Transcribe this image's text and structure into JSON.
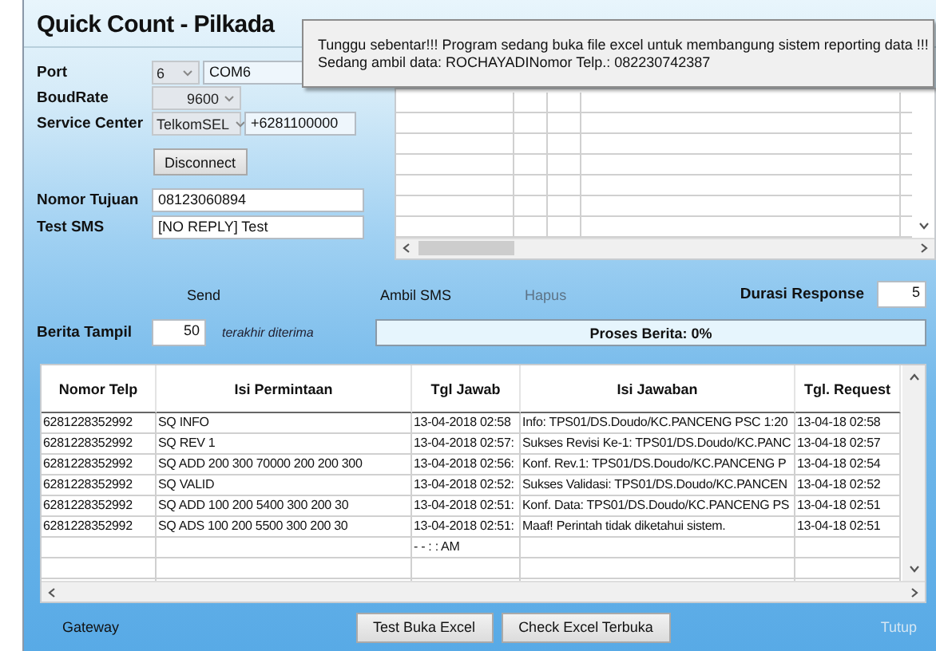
{
  "window": {
    "title": "Quick Count - Pilkada"
  },
  "notification": {
    "lines": [
      "Tunggu sebentar!!! Program sedang buka file excel untuk membangung sistem reporting data !!!",
      "Sedang ambil data: ROCHAYADINomor Telp.: 082230742387"
    ]
  },
  "settings": {
    "port": {
      "label": "Port",
      "number": "6",
      "name": "COM6"
    },
    "baud_rate": {
      "label": "BoudRate",
      "value": "9600"
    },
    "service_center": {
      "label": "Service Center",
      "operator": "TelkomSEL",
      "number": "+6281100000"
    }
  },
  "disconnect_button": "Disconnect",
  "destination": {
    "label": "Nomor Tujuan",
    "value": "08123060894"
  },
  "test_sms": {
    "label": "Test SMS",
    "value": "[NO REPLY] Test"
  },
  "actions": [
    {
      "label": "Send",
      "disabled": false
    },
    {
      "label": "Ambil SMS",
      "disabled": false
    },
    {
      "label": "Hapus",
      "disabled": true
    }
  ],
  "response_duration": {
    "label": "Durasi Response",
    "value": "5"
  },
  "shown": {
    "label": "Berita Tampil",
    "value": "50",
    "note": "terakhir diterima"
  },
  "progress": {
    "label": "Proses Berita: 0%",
    "level": 0
  },
  "table": {
    "columns": [
      "Nomor Telp",
      "Isi Permintaan",
      "Tgl Jawab",
      "Isi Jawaban",
      "Tgl. Request"
    ],
    "rows": [
      [
        "6281228352992",
        "SQ INFO",
        "13-04-2018 02:58",
        "Info: TPS01/DS.Doudo/KC.PANCENG PSC 1:20",
        "13-04-18 02:58"
      ],
      [
        "6281228352992",
        "SQ REV 1",
        "13-04-2018 02:57:",
        "Sukses Revisi Ke-1: TPS01/DS.Doudo/KC.PANC",
        "13-04-18 02:57"
      ],
      [
        "6281228352992",
        "SQ ADD 200 300 70000 200 200 300",
        "13-04-2018 02:56:",
        "Konf. Rev.1: TPS01/DS.Doudo/KC.PANCENG P",
        "13-04-18 02:54"
      ],
      [
        "6281228352992",
        "SQ VALID",
        "13-04-2018 02:52:",
        "Sukses Validasi: TPS01/DS.Doudo/KC.PANCEN",
        "13-04-18 02:52"
      ],
      [
        "6281228352992",
        "SQ ADD 100 200 5400 300 200 30",
        "13-04-2018 02:51:",
        "Konf. Data: TPS01/DS.Doudo/KC.PANCENG PS",
        "13-04-18 02:51"
      ],
      [
        "6281228352992",
        "SQ ADS 100 200 5500 300 200 30",
        "13-04-2018 02:51:",
        "Maaf! Perintah tidak diketahui sistem.",
        "13-04-18 02:51"
      ],
      [
        null,
        null,
        "- -     : :  AM",
        null,
        null
      ]
    ]
  },
  "footer": {
    "gateway": "Gateway",
    "buttons": [
      "Test Buka Excel",
      "Check Excel Terbuka"
    ],
    "close": {
      "label": "Tutup",
      "disabled": true
    }
  }
}
